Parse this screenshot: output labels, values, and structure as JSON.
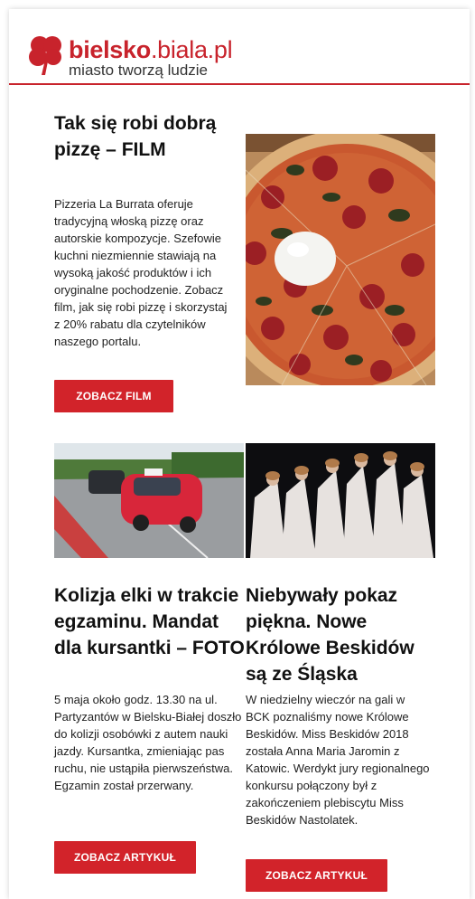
{
  "brand": {
    "name_bold": "bielsko",
    "name_rest": ".biala.pl",
    "tagline": "miasto tworzą ludzie",
    "color": "#c8232c"
  },
  "article1": {
    "title": "Tak się robi dobrą pizzę – FILM",
    "body": "Pizzeria La Burrata oferuje tradycyjną włoską pizzę oraz autorskie kompozycje. Szefowie kuchni niezmiennie stawiają na wysoką jakość produktów i ich oryginalne pochodzenie. Zobacz film, jak się robi pizzę i skorzystaj z 20% rabatu dla czytelników naszego portalu.",
    "button": "ZOBACZ FILM"
  },
  "article2": {
    "title": "Kolizja elki w trakcie egzaminu. Mandat dla kursantki – FOTO",
    "body": "5 maja około godz. 13.30 na ul. Partyzantów w Bielsku-Białej doszło do kolizji osobówki z autem nauki jazdy. Kursantka, zmieniając pas ruchu, nie ustąpiła pierwszeństwa. Egzamin został przerwany.",
    "button": "ZOBACZ ARTYKUŁ"
  },
  "article3": {
    "title": "Niebywały pokaz piękna. Nowe Królowe Beskidów są ze Śląska",
    "body": "W niedzielny wieczór na gali w BCK poznaliśmy nowe Królowe Beskidów. Miss Beskidów 2018 została Anna Maria Jaromin z Katowic. Werdykt jury regionalnego konkursu połączony był z zakończeniem plebiscytu Miss Beskidów Nastolatek.",
    "button": "ZOBACZ ARTYKUŁ"
  },
  "colors": {
    "button": "#d2232a"
  }
}
